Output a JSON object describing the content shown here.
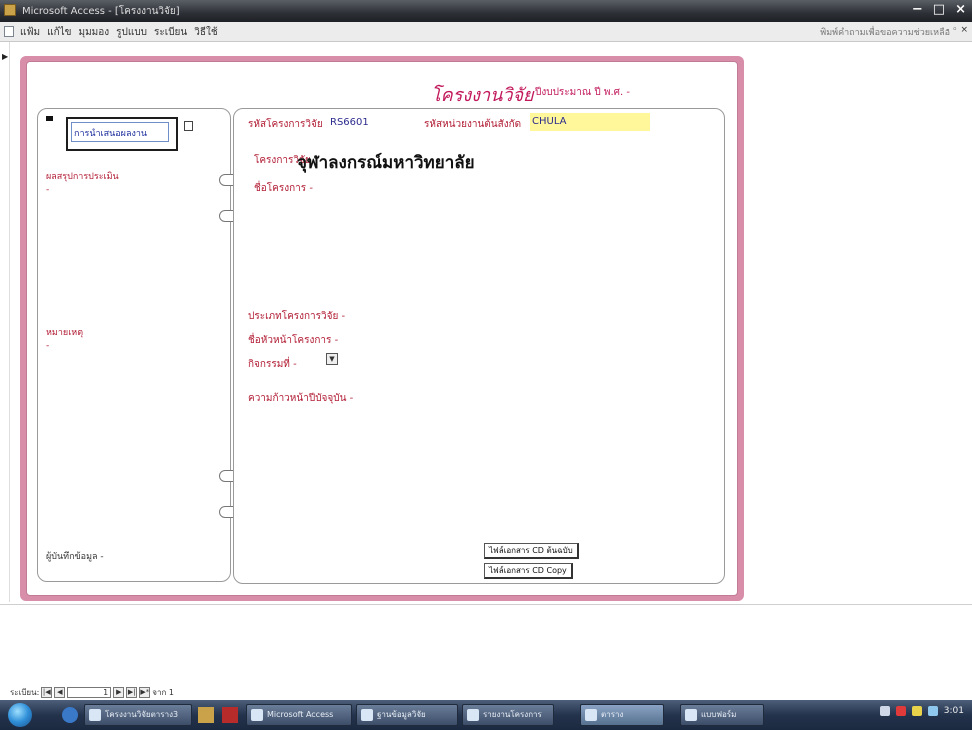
{
  "window": {
    "title": "Microsoft Access - [โครงงานวิจัย]",
    "controls": [
      "−",
      "□",
      "×"
    ]
  },
  "menu": {
    "items": [
      "แฟ้ม",
      "แก้ไข",
      "มุมมอง",
      "รูปแบบ",
      "ระเบียน",
      "วิธีใช้"
    ],
    "help_placeholder": "พิมพ์คำถามเพื่อขอความช่วยเหลือ",
    "mdi_controls": "- ◦ ×"
  },
  "form": {
    "title": "โครงงานวิจัย",
    "subtitle": "ปีงบประมาณ ปี พ.ศ. -",
    "left_panel": {
      "status_value": "การนำเสนอผลงาน",
      "status_label_1": "ผลสรุปการประเมิน",
      "status_value_1": "-",
      "notes_label": "หมายเหตุ",
      "notes_value": "-",
      "footer_label": "ผู้บันทึกข้อมูล -"
    },
    "main": {
      "project_code_label": "รหัสโครงการวิจัย",
      "project_code_value": "RS6601",
      "agency_code_label": "รหัสหน่วยงานต้นสังกัด",
      "agency_code_value": "CHULA",
      "university_label": "โครงการวิจัย",
      "university_value": "จุฬาลงกรณ์มหาวิทยาลัย",
      "project_name_label": "ชื่อโครงการ -",
      "type_label": "ประเภทโครงการวิจัย -",
      "head_label": "ชื่อหัวหน้าโครงการ -",
      "mission_label": "กิจกรรมที่ -",
      "progress_label": "ความก้าวหน้าปีบัจจุบัน -",
      "btn_primary": "ไฟล์เอกสาร CD ต้นฉบับ",
      "btn_copy": "ไฟล์เอกสาร CD Copy"
    }
  },
  "record_nav": {
    "label": "ระเบียน:",
    "current": "1",
    "total_label": "จาก 1"
  },
  "taskbar": {
    "tasks": [
      "โครงงานวิจัยตาราง3",
      "Microsoft Access",
      "ฐานข้อมูลวิจัย",
      "รายงานโครงการ",
      "หน้าเว็บ",
      "ตาราง",
      "แบบฟอร์ม"
    ],
    "clock": "3:01"
  }
}
